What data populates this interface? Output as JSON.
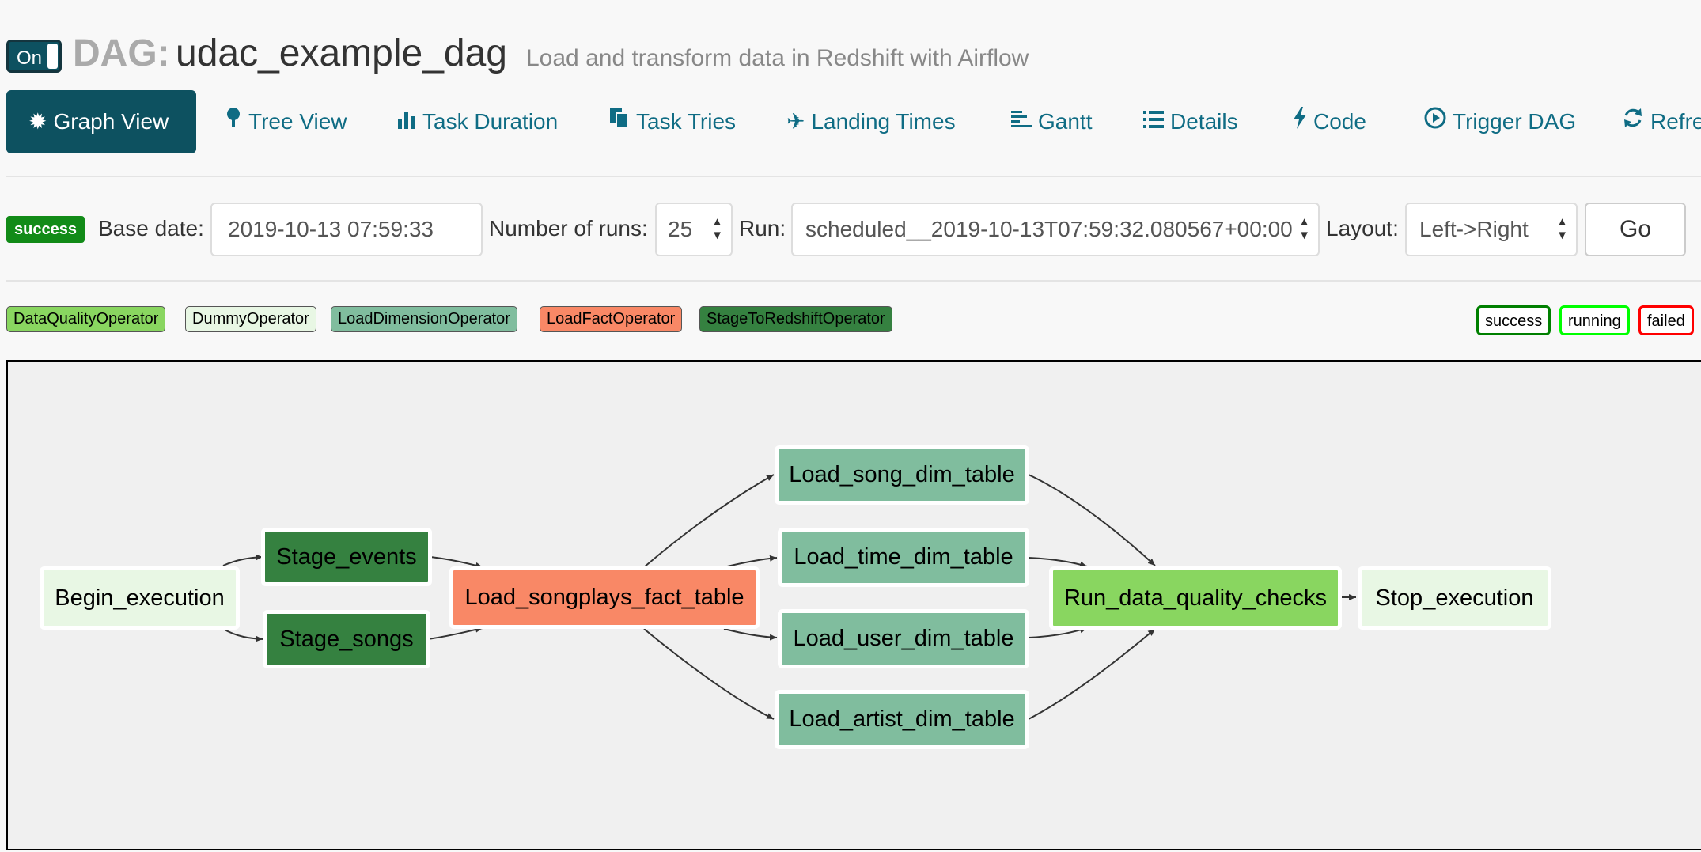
{
  "header": {
    "toggle_label": "On",
    "dag_prefix": "DAG:",
    "dag_id": "udac_example_dag",
    "description": "Load and transform data in Redshift with Airflow"
  },
  "nav": {
    "tabs": [
      {
        "label": "Graph View",
        "icon": "asterisk-icon",
        "active": true
      },
      {
        "label": "Tree View",
        "icon": "tree-icon"
      },
      {
        "label": "Task Duration",
        "icon": "bar-chart-icon"
      },
      {
        "label": "Task Tries",
        "icon": "duplicate-icon"
      },
      {
        "label": "Landing Times",
        "icon": "plane-icon"
      },
      {
        "label": "Gantt",
        "icon": "align-left-icon"
      },
      {
        "label": "Details",
        "icon": "list-icon"
      },
      {
        "label": "Code",
        "icon": "flash-icon"
      },
      {
        "label": "Trigger DAG",
        "icon": "play-circle-icon"
      },
      {
        "label": "Refre",
        "icon": "refresh-icon"
      }
    ]
  },
  "form": {
    "state_badge": "success",
    "base_date_label": "Base date:",
    "base_date_value": "2019-10-13 07:59:33",
    "num_runs_label": "Number of runs:",
    "num_runs_value": "25",
    "run_label": "Run:",
    "run_value": "scheduled__2019-10-13T07:59:32.080567+00:00",
    "layout_label": "Layout:",
    "layout_value": "Left->Right",
    "go_label": "Go"
  },
  "legend": {
    "operators": [
      {
        "label": "DataQualityOperator",
        "color": "#89d660"
      },
      {
        "label": "DummyOperator",
        "color": "#e8f7e4"
      },
      {
        "label": "LoadDimensionOperator",
        "color": "#80bd9e"
      },
      {
        "label": "LoadFactOperator",
        "color": "#f98866"
      },
      {
        "label": "StageToRedshiftOperator",
        "color": "#358140"
      }
    ],
    "states": [
      {
        "label": "success",
        "color": "#008000"
      },
      {
        "label": "running",
        "color": "#00ff00"
      },
      {
        "label": "failed",
        "color": "#ff0000"
      }
    ]
  },
  "graph": {
    "nodes": [
      {
        "label": "Begin_execution",
        "operator": "DummyOperator"
      },
      {
        "label": "Stage_events",
        "operator": "StageToRedshiftOperator"
      },
      {
        "label": "Stage_songs",
        "operator": "StageToRedshiftOperator"
      },
      {
        "label": "Load_songplays_fact_table",
        "operator": "LoadFactOperator"
      },
      {
        "label": "Load_song_dim_table",
        "operator": "LoadDimensionOperator"
      },
      {
        "label": "Load_time_dim_table",
        "operator": "LoadDimensionOperator"
      },
      {
        "label": "Load_user_dim_table",
        "operator": "LoadDimensionOperator"
      },
      {
        "label": "Load_artist_dim_table",
        "operator": "LoadDimensionOperator"
      },
      {
        "label": "Run_data_quality_checks",
        "operator": "DataQualityOperator"
      },
      {
        "label": "Stop_execution",
        "operator": "DummyOperator"
      }
    ]
  }
}
